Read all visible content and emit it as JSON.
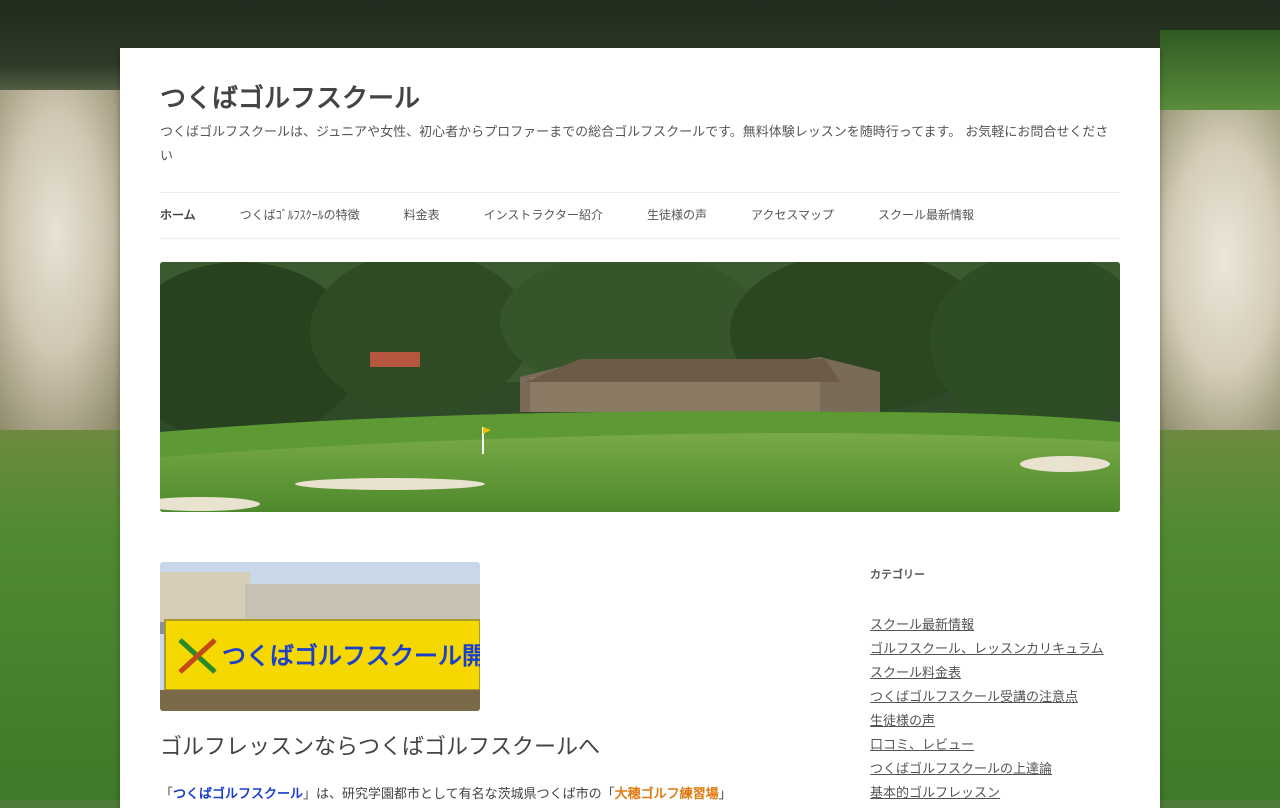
{
  "site": {
    "title": "つくばゴルフスクール",
    "description": "つくばゴルフスクールは、ジュニアや女性、初心者からプロファーまでの総合ゴルフスクールです。無料体験レッスンを随時行ってます。 お気軽にお問合せください"
  },
  "nav": {
    "items": [
      {
        "label": "ホーム"
      },
      {
        "label": "つくばｺﾞﾙﾌｽｸｰﾙの特徴"
      },
      {
        "label": "料金表"
      },
      {
        "label": "インストラクター紹介"
      },
      {
        "label": "生徒様の声"
      },
      {
        "label": "アクセスマップ"
      },
      {
        "label": "スクール最新情報"
      }
    ]
  },
  "post": {
    "banner_text": "つくばゴルフスクール開校中",
    "title": "ゴルフレッスンならつくばゴルフスクールへ",
    "text_open": "「",
    "text_hl": "つくばゴルフスクール",
    "text_mid": "」は、研究学園都市として有名な茨城県つくば市の「",
    "text_hl2": "大穂ゴルフ練習場",
    "text_close": "」"
  },
  "sidebar": {
    "widget_title": "カテゴリー",
    "categories": [
      "スクール最新情報",
      "ゴルフスクール、レッスンカリキュラム",
      "スクール料金表",
      "つくばゴルフスクール受講の注意点",
      "生徒様の声",
      "口コミ、レビュー",
      "つくばゴルフスクールの上達論",
      "基本的ゴルフレッスン"
    ]
  },
  "colors": {
    "link_highlight": "#1a3fcc",
    "link_highlight2": "#e07a10",
    "banner_yellow": "#f5d800"
  }
}
